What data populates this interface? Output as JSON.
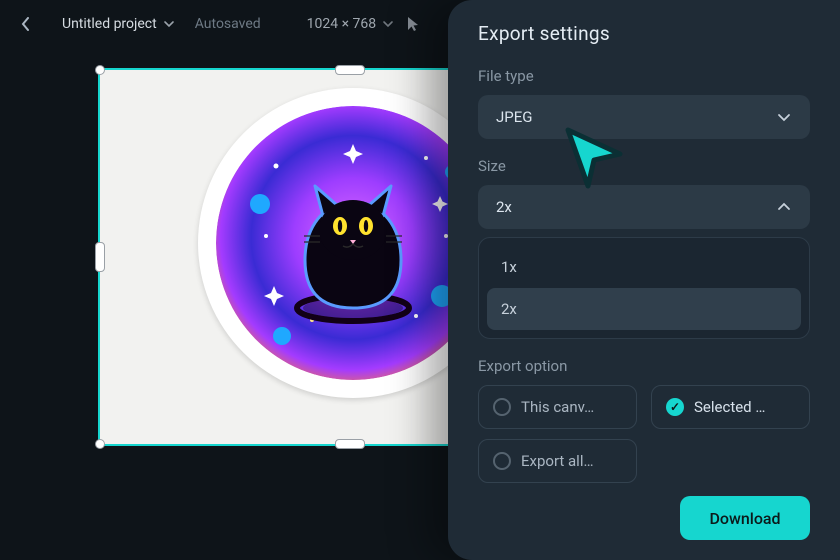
{
  "topbar": {
    "project_name": "Untitled project",
    "autosaved_label": "Autosaved",
    "dimensions": "1024 × 768"
  },
  "panel": {
    "title": "Export settings",
    "filetype": {
      "label": "File type",
      "value": "JPEG"
    },
    "size": {
      "label": "Size",
      "value": "2x",
      "options": [
        "1x",
        "2x"
      ],
      "selected_index": 1
    },
    "export_option": {
      "label": "Export option",
      "options": [
        "This canv…",
        "Selected …",
        "Export all…"
      ],
      "selected_index": 1
    },
    "download_label": "Download"
  },
  "colors": {
    "accent": "#16d6cf"
  }
}
